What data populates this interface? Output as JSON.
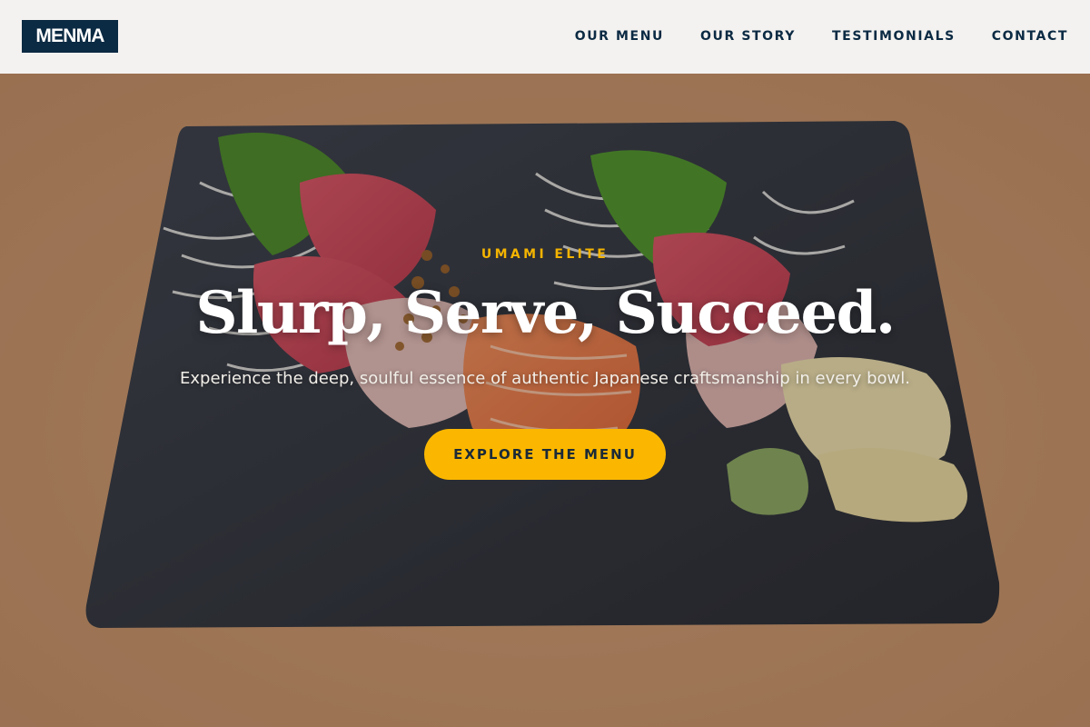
{
  "brand": {
    "logo_text": "MENMA"
  },
  "nav": {
    "items": [
      {
        "label": "OUR MENU"
      },
      {
        "label": "OUR STORY"
      },
      {
        "label": "TESTIMONIALS"
      },
      {
        "label": "CONTACT"
      }
    ]
  },
  "hero": {
    "eyebrow": "UMAMI ELITE",
    "headline": "Slurp, Serve, Succeed.",
    "subheadline": "Experience the deep, soulful essence of authentic Japanese craftsmanship in every bowl.",
    "cta_label": "EXPLORE THE MENU",
    "background_image": "sashimi-platter-on-slate-board"
  },
  "colors": {
    "header_bg": "#f4f2f0",
    "brand_navy": "#0b2a43",
    "accent_gold": "#fbb700",
    "eyebrow_gold": "#f4b400"
  }
}
